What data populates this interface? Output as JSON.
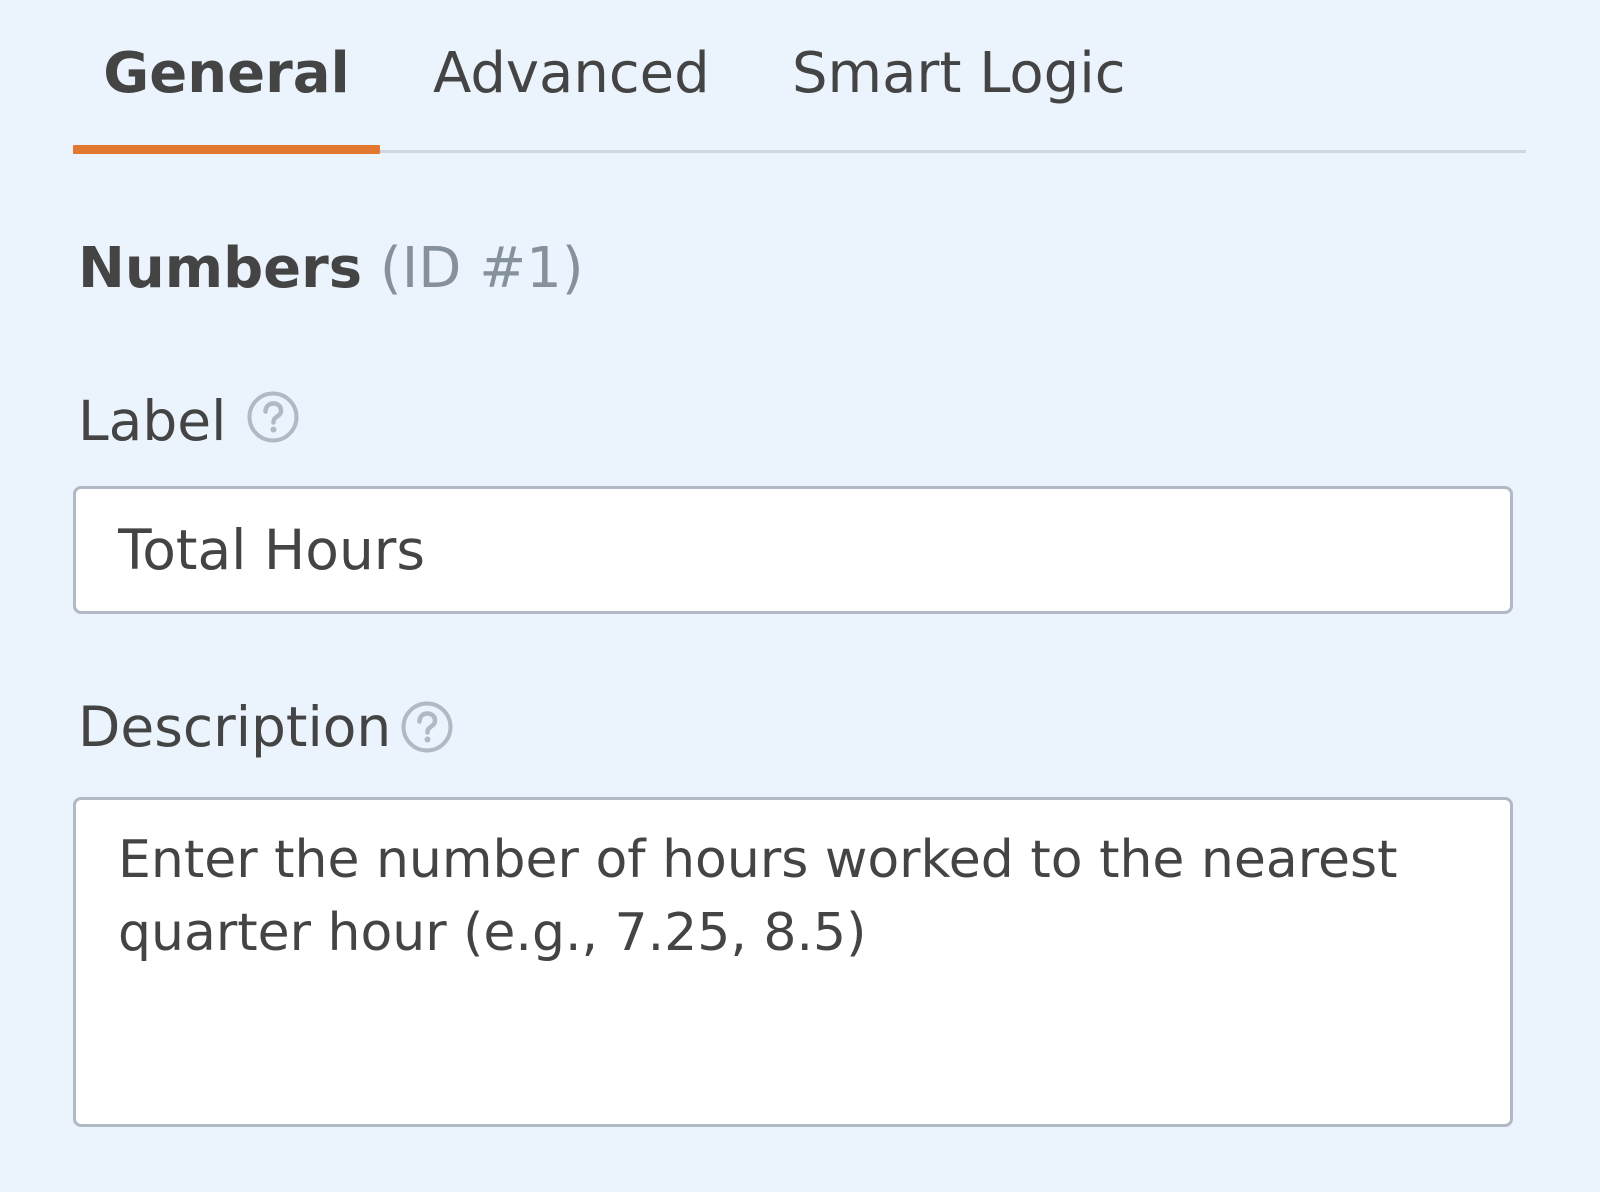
{
  "tabs": [
    {
      "label": "General",
      "active": true
    },
    {
      "label": "Advanced",
      "active": false
    },
    {
      "label": "Smart Logic",
      "active": false
    }
  ],
  "field": {
    "type": "Numbers",
    "id_text": "(ID #1)"
  },
  "label_option": {
    "label": "Label",
    "value": "Total Hours"
  },
  "description_option": {
    "label": "Description",
    "value": "Enter the number of hours worked to the nearest quarter hour (e.g., 7.25, 8.5)"
  },
  "icons": {
    "help": "question-circle-icon"
  },
  "colors": {
    "background": "#ebf3fc",
    "accent": "#e27730",
    "tab_rule": "#ced7e0",
    "input_border": "#b0b9c4",
    "text": "#444444",
    "muted_text": "#86919e",
    "icon": "#b0b9c4"
  }
}
